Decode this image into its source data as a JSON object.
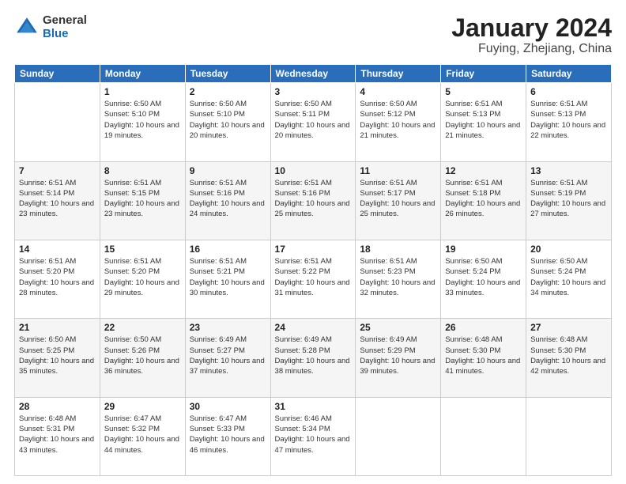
{
  "header": {
    "logo_general": "General",
    "logo_blue": "Blue",
    "title": "January 2024",
    "location": "Fuying, Zhejiang, China"
  },
  "columns": [
    "Sunday",
    "Monday",
    "Tuesday",
    "Wednesday",
    "Thursday",
    "Friday",
    "Saturday"
  ],
  "weeks": [
    [
      {
        "day": "",
        "sunrise": "",
        "sunset": "",
        "daylight": ""
      },
      {
        "day": "1",
        "sunrise": "Sunrise: 6:50 AM",
        "sunset": "Sunset: 5:10 PM",
        "daylight": "Daylight: 10 hours and 19 minutes."
      },
      {
        "day": "2",
        "sunrise": "Sunrise: 6:50 AM",
        "sunset": "Sunset: 5:10 PM",
        "daylight": "Daylight: 10 hours and 20 minutes."
      },
      {
        "day": "3",
        "sunrise": "Sunrise: 6:50 AM",
        "sunset": "Sunset: 5:11 PM",
        "daylight": "Daylight: 10 hours and 20 minutes."
      },
      {
        "day": "4",
        "sunrise": "Sunrise: 6:50 AM",
        "sunset": "Sunset: 5:12 PM",
        "daylight": "Daylight: 10 hours and 21 minutes."
      },
      {
        "day": "5",
        "sunrise": "Sunrise: 6:51 AM",
        "sunset": "Sunset: 5:13 PM",
        "daylight": "Daylight: 10 hours and 21 minutes."
      },
      {
        "day": "6",
        "sunrise": "Sunrise: 6:51 AM",
        "sunset": "Sunset: 5:13 PM",
        "daylight": "Daylight: 10 hours and 22 minutes."
      }
    ],
    [
      {
        "day": "7",
        "sunrise": "Sunrise: 6:51 AM",
        "sunset": "Sunset: 5:14 PM",
        "daylight": "Daylight: 10 hours and 23 minutes."
      },
      {
        "day": "8",
        "sunrise": "Sunrise: 6:51 AM",
        "sunset": "Sunset: 5:15 PM",
        "daylight": "Daylight: 10 hours and 23 minutes."
      },
      {
        "day": "9",
        "sunrise": "Sunrise: 6:51 AM",
        "sunset": "Sunset: 5:16 PM",
        "daylight": "Daylight: 10 hours and 24 minutes."
      },
      {
        "day": "10",
        "sunrise": "Sunrise: 6:51 AM",
        "sunset": "Sunset: 5:16 PM",
        "daylight": "Daylight: 10 hours and 25 minutes."
      },
      {
        "day": "11",
        "sunrise": "Sunrise: 6:51 AM",
        "sunset": "Sunset: 5:17 PM",
        "daylight": "Daylight: 10 hours and 25 minutes."
      },
      {
        "day": "12",
        "sunrise": "Sunrise: 6:51 AM",
        "sunset": "Sunset: 5:18 PM",
        "daylight": "Daylight: 10 hours and 26 minutes."
      },
      {
        "day": "13",
        "sunrise": "Sunrise: 6:51 AM",
        "sunset": "Sunset: 5:19 PM",
        "daylight": "Daylight: 10 hours and 27 minutes."
      }
    ],
    [
      {
        "day": "14",
        "sunrise": "Sunrise: 6:51 AM",
        "sunset": "Sunset: 5:20 PM",
        "daylight": "Daylight: 10 hours and 28 minutes."
      },
      {
        "day": "15",
        "sunrise": "Sunrise: 6:51 AM",
        "sunset": "Sunset: 5:20 PM",
        "daylight": "Daylight: 10 hours and 29 minutes."
      },
      {
        "day": "16",
        "sunrise": "Sunrise: 6:51 AM",
        "sunset": "Sunset: 5:21 PM",
        "daylight": "Daylight: 10 hours and 30 minutes."
      },
      {
        "day": "17",
        "sunrise": "Sunrise: 6:51 AM",
        "sunset": "Sunset: 5:22 PM",
        "daylight": "Daylight: 10 hours and 31 minutes."
      },
      {
        "day": "18",
        "sunrise": "Sunrise: 6:51 AM",
        "sunset": "Sunset: 5:23 PM",
        "daylight": "Daylight: 10 hours and 32 minutes."
      },
      {
        "day": "19",
        "sunrise": "Sunrise: 6:50 AM",
        "sunset": "Sunset: 5:24 PM",
        "daylight": "Daylight: 10 hours and 33 minutes."
      },
      {
        "day": "20",
        "sunrise": "Sunrise: 6:50 AM",
        "sunset": "Sunset: 5:24 PM",
        "daylight": "Daylight: 10 hours and 34 minutes."
      }
    ],
    [
      {
        "day": "21",
        "sunrise": "Sunrise: 6:50 AM",
        "sunset": "Sunset: 5:25 PM",
        "daylight": "Daylight: 10 hours and 35 minutes."
      },
      {
        "day": "22",
        "sunrise": "Sunrise: 6:50 AM",
        "sunset": "Sunset: 5:26 PM",
        "daylight": "Daylight: 10 hours and 36 minutes."
      },
      {
        "day": "23",
        "sunrise": "Sunrise: 6:49 AM",
        "sunset": "Sunset: 5:27 PM",
        "daylight": "Daylight: 10 hours and 37 minutes."
      },
      {
        "day": "24",
        "sunrise": "Sunrise: 6:49 AM",
        "sunset": "Sunset: 5:28 PM",
        "daylight": "Daylight: 10 hours and 38 minutes."
      },
      {
        "day": "25",
        "sunrise": "Sunrise: 6:49 AM",
        "sunset": "Sunset: 5:29 PM",
        "daylight": "Daylight: 10 hours and 39 minutes."
      },
      {
        "day": "26",
        "sunrise": "Sunrise: 6:48 AM",
        "sunset": "Sunset: 5:30 PM",
        "daylight": "Daylight: 10 hours and 41 minutes."
      },
      {
        "day": "27",
        "sunrise": "Sunrise: 6:48 AM",
        "sunset": "Sunset: 5:30 PM",
        "daylight": "Daylight: 10 hours and 42 minutes."
      }
    ],
    [
      {
        "day": "28",
        "sunrise": "Sunrise: 6:48 AM",
        "sunset": "Sunset: 5:31 PM",
        "daylight": "Daylight: 10 hours and 43 minutes."
      },
      {
        "day": "29",
        "sunrise": "Sunrise: 6:47 AM",
        "sunset": "Sunset: 5:32 PM",
        "daylight": "Daylight: 10 hours and 44 minutes."
      },
      {
        "day": "30",
        "sunrise": "Sunrise: 6:47 AM",
        "sunset": "Sunset: 5:33 PM",
        "daylight": "Daylight: 10 hours and 46 minutes."
      },
      {
        "day": "31",
        "sunrise": "Sunrise: 6:46 AM",
        "sunset": "Sunset: 5:34 PM",
        "daylight": "Daylight: 10 hours and 47 minutes."
      },
      {
        "day": "",
        "sunrise": "",
        "sunset": "",
        "daylight": ""
      },
      {
        "day": "",
        "sunrise": "",
        "sunset": "",
        "daylight": ""
      },
      {
        "day": "",
        "sunrise": "",
        "sunset": "",
        "daylight": ""
      }
    ]
  ]
}
